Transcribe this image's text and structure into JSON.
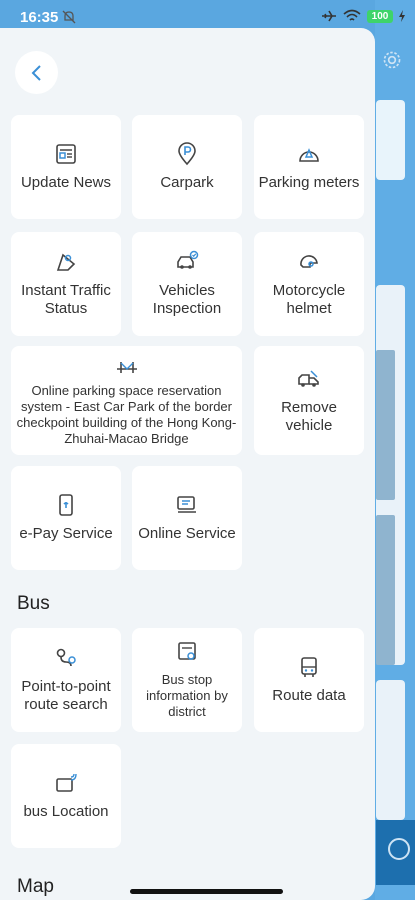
{
  "status_bar": {
    "time": "16:35",
    "battery": "100"
  },
  "drawer": {
    "tiles_top": [
      {
        "label": "Update News",
        "icon": "news-icon"
      },
      {
        "label": "Carpark",
        "icon": "parking-icon"
      },
      {
        "label": "Parking meters",
        "icon": "parking-meter-icon"
      },
      {
        "label": "Instant Traffic Status",
        "icon": "traffic-icon"
      },
      {
        "label": "Vehicles Inspection",
        "icon": "vehicle-inspection-icon"
      },
      {
        "label": "Motorcycle helmet",
        "icon": "helmet-icon"
      },
      {
        "label": "Online parking space reservation system - East Car Park of the border checkpoint building of the Hong Kong-Zhuhai-Macao Bridge",
        "icon": "bridge-icon"
      },
      {
        "label": "Remove vehicle",
        "icon": "tow-truck-icon"
      },
      {
        "label": "e-Pay Service",
        "icon": "epay-icon"
      },
      {
        "label": "Online Service",
        "icon": "online-service-icon"
      }
    ],
    "bus_section": {
      "title": "Bus",
      "tiles": [
        {
          "label": "Point-to-point route search",
          "icon": "route-search-icon"
        },
        {
          "label": "Bus stop information by district",
          "icon": "bus-stop-icon"
        },
        {
          "label": "Route data",
          "icon": "bus-icon"
        },
        {
          "label": "bus Location",
          "icon": "bus-location-icon"
        }
      ]
    },
    "map_section": {
      "title": "Map"
    }
  },
  "colors": {
    "accent": "#3a8fd6",
    "icon_stroke": "#444444",
    "background_app": "#5aa7e0"
  }
}
